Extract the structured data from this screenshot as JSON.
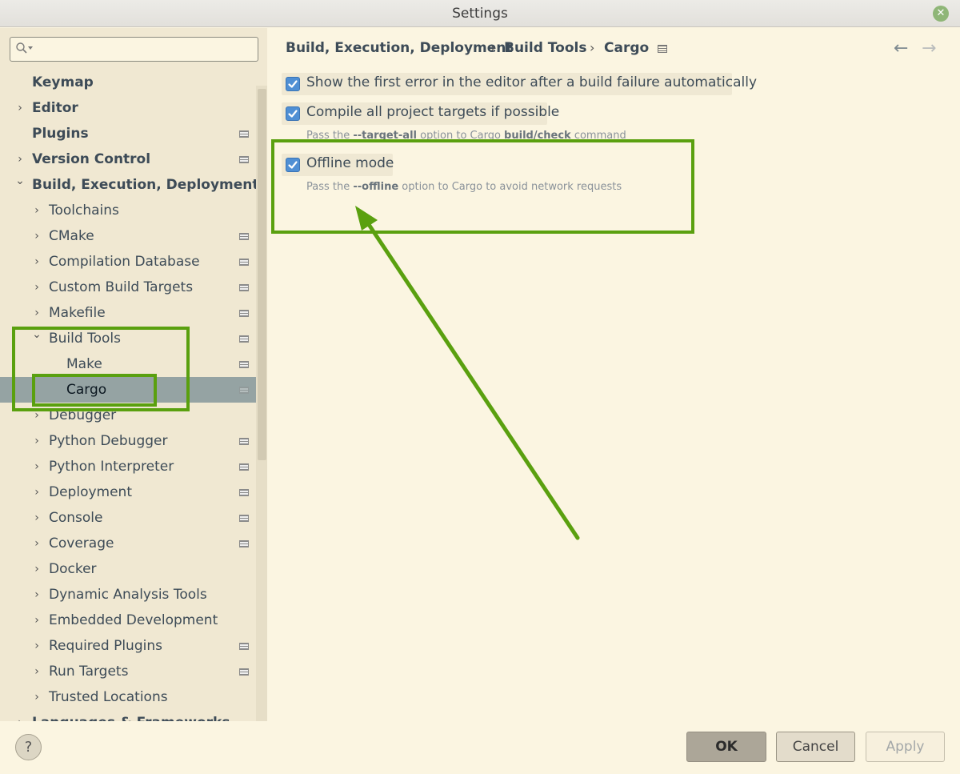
{
  "window": {
    "title": "Settings"
  },
  "search": {
    "placeholder": ""
  },
  "sidebar": {
    "items": [
      {
        "label": "Keymap",
        "arrow": "",
        "bold": true,
        "pinned": false
      },
      {
        "label": "Editor",
        "arrow": "›",
        "bold": true,
        "pinned": false
      },
      {
        "label": "Plugins",
        "arrow": "",
        "bold": true,
        "pinned": true
      },
      {
        "label": "Version Control",
        "arrow": "›",
        "bold": true,
        "pinned": true
      },
      {
        "label": "Build, Execution, Deployment",
        "arrow": "⌄",
        "bold": true,
        "pinned": false
      },
      {
        "label": "Toolchains",
        "arrow": "›",
        "bold": false,
        "pinned": false
      },
      {
        "label": "CMake",
        "arrow": "›",
        "bold": false,
        "pinned": true
      },
      {
        "label": "Compilation Database",
        "arrow": "›",
        "bold": false,
        "pinned": true
      },
      {
        "label": "Custom Build Targets",
        "arrow": "›",
        "bold": false,
        "pinned": true
      },
      {
        "label": "Makefile",
        "arrow": "›",
        "bold": false,
        "pinned": true
      },
      {
        "label": "Build Tools",
        "arrow": "⌄",
        "bold": false,
        "pinned": true
      },
      {
        "label": "Make",
        "arrow": "",
        "bold": false,
        "pinned": true
      },
      {
        "label": "Cargo",
        "arrow": "",
        "bold": false,
        "pinned": true,
        "selected": true
      },
      {
        "label": "Debugger",
        "arrow": "›",
        "bold": false,
        "pinned": false
      },
      {
        "label": "Python Debugger",
        "arrow": "›",
        "bold": false,
        "pinned": true
      },
      {
        "label": "Python Interpreter",
        "arrow": "›",
        "bold": false,
        "pinned": true
      },
      {
        "label": "Deployment",
        "arrow": "›",
        "bold": false,
        "pinned": true
      },
      {
        "label": "Console",
        "arrow": "›",
        "bold": false,
        "pinned": true
      },
      {
        "label": "Coverage",
        "arrow": "›",
        "bold": false,
        "pinned": true
      },
      {
        "label": "Docker",
        "arrow": "›",
        "bold": false,
        "pinned": false
      },
      {
        "label": "Dynamic Analysis Tools",
        "arrow": "›",
        "bold": false,
        "pinned": false
      },
      {
        "label": "Embedded Development",
        "arrow": "›",
        "bold": false,
        "pinned": false
      },
      {
        "label": "Required Plugins",
        "arrow": "›",
        "bold": false,
        "pinned": true
      },
      {
        "label": "Run Targets",
        "arrow": "›",
        "bold": false,
        "pinned": true
      },
      {
        "label": "Trusted Locations",
        "arrow": "›",
        "bold": false,
        "pinned": false
      },
      {
        "label": "Languages & Frameworks",
        "arrow": "›",
        "bold": true,
        "pinned": false
      }
    ]
  },
  "breadcrumb": {
    "items": [
      "Build, Execution, Deployment",
      "Build Tools",
      "Cargo"
    ],
    "separator": "›"
  },
  "options": {
    "show_first_error": {
      "label": "Show the first error in the editor after a build failure automatically",
      "checked": true
    },
    "compile_all_targets": {
      "label": "Compile all project targets if possible",
      "checked": true,
      "hint_prefix": "Pass the ",
      "hint_flag": "--target-all",
      "hint_middle": " option to Cargo ",
      "hint_cmd": "build/check",
      "hint_suffix": " command"
    },
    "offline_mode": {
      "label": "Offline mode",
      "checked": true,
      "hint_prefix": "Pass the ",
      "hint_flag": "--offline",
      "hint_suffix": " option to Cargo to avoid network requests"
    }
  },
  "buttons": {
    "help": "?",
    "ok": "OK",
    "cancel": "Cancel",
    "apply": "Apply"
  },
  "colors": {
    "highlight": "#5aa00f",
    "checkbox": "#4f8fd4",
    "selection": "#95a3a3"
  }
}
